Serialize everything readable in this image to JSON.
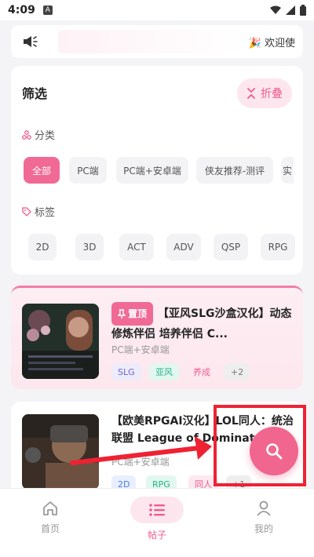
{
  "status": {
    "time": "4:09",
    "a": "A"
  },
  "notice": {
    "text": "🎉 欢迎使"
  },
  "filter": {
    "title": "筛选",
    "fold_label": "折叠",
    "category_label": "分类",
    "categories": [
      "全部",
      "PC端",
      "PC端+安卓端",
      "侠友推荐-测评",
      "实"
    ],
    "tag_label": "标签",
    "tags": [
      "2D",
      "3D",
      "ACT",
      "ADV",
      "QSP",
      "RPG"
    ]
  },
  "posts": [
    {
      "pin": "置顶",
      "title": "【亚风SLG沙盒汉化】动态 修炼伴侣 培养伴侣 C...",
      "platform": "PC端+安卓端",
      "tags": [
        "SLG",
        "亚风",
        "养成",
        "+2"
      ]
    },
    {
      "title": "【欧美RPGAI汉化】LOL同人：统治联盟 League of Dominat...",
      "platform": "PC端+安卓端",
      "tags": [
        "2D",
        "RPG",
        "同人",
        "+1"
      ]
    }
  ],
  "nav": {
    "home": "首页",
    "posts": "帖子",
    "mine": "我的"
  },
  "colors": {
    "accent": "#f06a95",
    "annotation": "#ee2233"
  },
  "icons": {
    "fab": "search-icon",
    "notice": "megaphone-icon"
  }
}
